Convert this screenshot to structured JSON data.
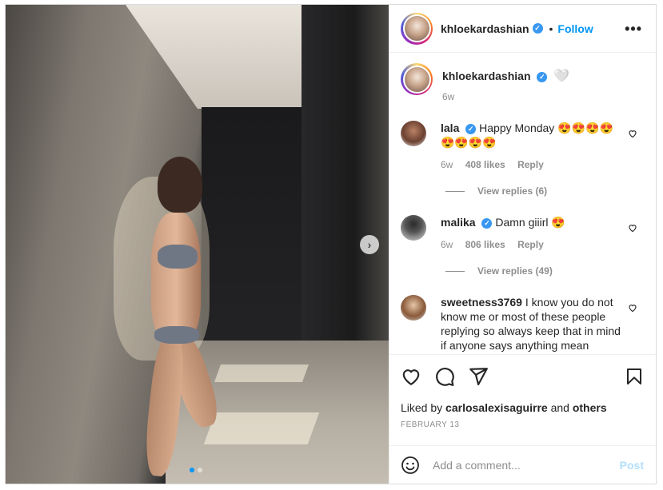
{
  "header": {
    "username": "khloekardashian",
    "verified_mark": "✓",
    "separator": "•",
    "follow_label": "Follow",
    "more_label": "•••"
  },
  "caption": {
    "username": "khloekardashian",
    "verified_mark": "✓",
    "text": "🤍",
    "time": "6w"
  },
  "comments": [
    {
      "username": "lala",
      "verified_mark": "✓",
      "text_line1": "Happy Monday 😍😍😍😍",
      "text_line2": "😍😍😍😍",
      "time": "6w",
      "likes": "408 likes",
      "reply_label": "Reply",
      "view_replies": "View replies (6)"
    },
    {
      "username": "malika",
      "verified_mark": "✓",
      "text_line1": "Damn giiirl 😍",
      "time": "6w",
      "likes": "806 likes",
      "reply_label": "Reply",
      "view_replies": "View replies (49)"
    },
    {
      "username": "sweetness3769",
      "text": "I know you do not know me or most of these people replying so always keep that in mind if anyone says anything mean"
    }
  ],
  "actions": {
    "liked_prefix": "Liked by",
    "liked_user": "carlosalexisaguirre",
    "liked_and": "and",
    "liked_others": "others",
    "date": "FEBRUARY 13"
  },
  "add_comment": {
    "placeholder": "Add a comment...",
    "post_label": "Post"
  },
  "media": {
    "next_label": "›",
    "slide_count": 2,
    "active_slide": 1
  },
  "icons": [
    "heart-icon",
    "comment-icon",
    "share-icon",
    "bookmark-icon",
    "emoji-icon",
    "chevron-right-icon",
    "more-icon",
    "verified-icon"
  ],
  "colors": {
    "accent": "#0095f6",
    "post_disabled": "#b2dffc",
    "muted": "#8e8e8e",
    "text": "#262626"
  }
}
